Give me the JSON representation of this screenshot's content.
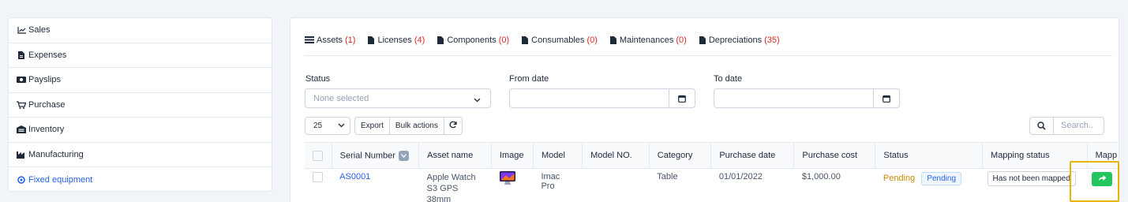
{
  "sidebar": {
    "items": [
      {
        "label": "Sales",
        "icon": "chart-line-icon"
      },
      {
        "label": "Expenses",
        "icon": "file-icon"
      },
      {
        "label": "Payslips",
        "icon": "money-icon"
      },
      {
        "label": "Purchase",
        "icon": "cart-icon"
      },
      {
        "label": "Inventory",
        "icon": "warehouse-icon"
      },
      {
        "label": "Manufacturing",
        "icon": "industry-icon"
      },
      {
        "label": "Fixed equipment",
        "icon": "gear-icon",
        "active": true
      }
    ]
  },
  "tabs": [
    {
      "label": "Assets",
      "count": "(1)"
    },
    {
      "label": "Licenses",
      "count": "(4)"
    },
    {
      "label": "Components",
      "count": "(0)"
    },
    {
      "label": "Consumables",
      "count": "(0)"
    },
    {
      "label": "Maintenances",
      "count": "(0)"
    },
    {
      "label": "Depreciations",
      "count": "(35)"
    }
  ],
  "filters": {
    "status_label": "Status",
    "status_placeholder": "None selected",
    "from_date_label": "From date",
    "to_date_label": "To date"
  },
  "toolbar": {
    "page_size": "25",
    "export_label": "Export",
    "bulk_label": "Bulk actions",
    "search_placeholder": "Search.."
  },
  "table": {
    "columns": [
      "Serial Number",
      "Asset name",
      "Image",
      "Model",
      "Model NO.",
      "Category",
      "Purchase date",
      "Purchase cost",
      "Status",
      "Mapping status",
      "Mapp"
    ],
    "rows": [
      {
        "serial": "AS0001",
        "asset_name_line1": "Apple Watch",
        "asset_name_line2": "S3 GPS 38mm",
        "model": "Imac Pro",
        "model_no": "",
        "category": "Table",
        "purchase_date": "01/01/2022",
        "purchase_cost": "$1,000.00",
        "status_text": "Pending",
        "status_badge": "Pending",
        "mapping_status": "Has not been mapped"
      }
    ]
  },
  "colors": {
    "accent": "#2563eb",
    "count_red": "#dc2626",
    "pending_yellow": "#ca8a04",
    "action_green": "#22c55e",
    "highlight": "#eab308"
  }
}
